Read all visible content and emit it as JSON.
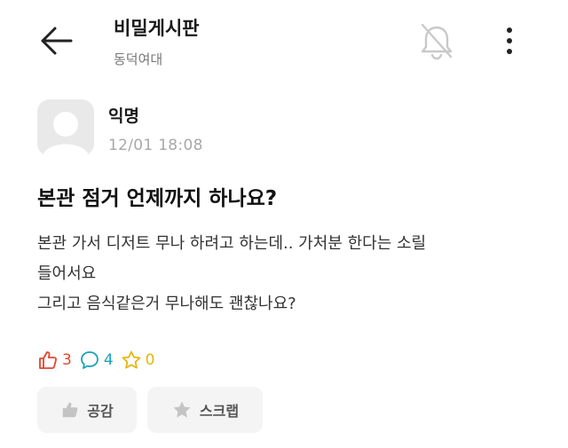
{
  "header": {
    "title": "비밀게시판",
    "subtitle": "동덕여대"
  },
  "post": {
    "author": "익명",
    "date": "12/01 18:08",
    "title": "본관 점거 언제까지 하나요?",
    "body_lines": [
      "본관 가서 디저트 무나 하려고 하는데.. 가처분 한다는 소릴",
      "들어서요",
      "그리고 음식같은거 무나해도 괜찮나요?"
    ]
  },
  "stats": {
    "likes": "3",
    "comments": "4",
    "scraps": "0"
  },
  "actions": {
    "like_label": "공감",
    "scrap_label": "스크랩"
  },
  "colors": {
    "like": "#e0452e",
    "comment": "#19a3b8",
    "scrap": "#e5b70a",
    "muted": "#a8a8a8",
    "button_bg": "#f4f4f4"
  },
  "icons": {
    "back": "arrow-left-icon",
    "notification": "bell-off-icon",
    "more": "vertical-dots-icon",
    "like": "thumbs-up-icon",
    "comment": "speech-bubble-icon",
    "scrap": "star-icon"
  }
}
